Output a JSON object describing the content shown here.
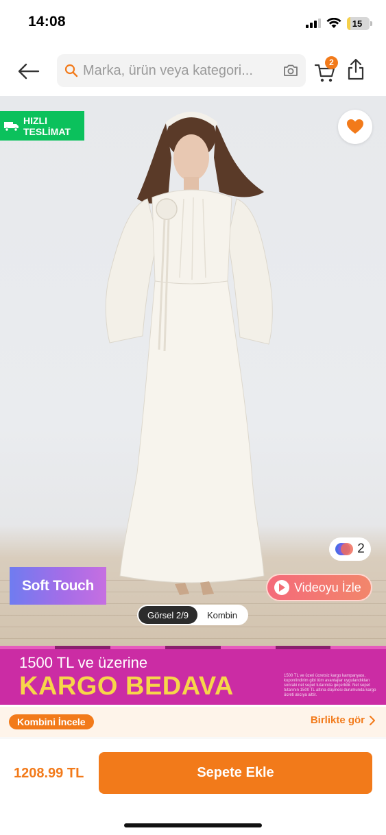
{
  "status_bar": {
    "time": "14:08",
    "battery": "15"
  },
  "header": {
    "search_placeholder": "Marka, ürün veya kategori...",
    "cart_count": "2",
    "icons": [
      "back-arrow-icon",
      "search-icon",
      "camera-icon",
      "cart-icon",
      "share-icon"
    ]
  },
  "product": {
    "fast_delivery": {
      "line1": "HIZLI",
      "line2": "TESLİMAT"
    },
    "color_count": "2",
    "soft_touch_label": "Soft Touch",
    "video_label": "Videoyu İzle",
    "gallery": {
      "active_label": "Görsel 2/9",
      "combine_label": "Kombin"
    }
  },
  "promo": {
    "line1": "1500 TL ve üzerine",
    "line2": "KARGO BEDAVA",
    "fine_print": "1500 TL ve üzeri ücretsiz kargo kampanyası, kupon/indirim gibi tüm avantajlar uygulandıktan sonraki net sepet tutarında geçerlidir. Net sepet tutarının 1500 TL altına düşmesi durumunda kargo ücreti alıcıya aittir."
  },
  "combine": {
    "pill_label": "Kombini İncele",
    "link_label": "Birlikte gör"
  },
  "bottom": {
    "price": "1208.99 TL",
    "add_to_cart": "Sepete Ekle"
  },
  "colors": {
    "brand_orange": "#f27a1a",
    "fast_green": "#0bc15c",
    "promo_magenta": "#cb2ca4",
    "promo_yellow": "#f7d54a"
  }
}
